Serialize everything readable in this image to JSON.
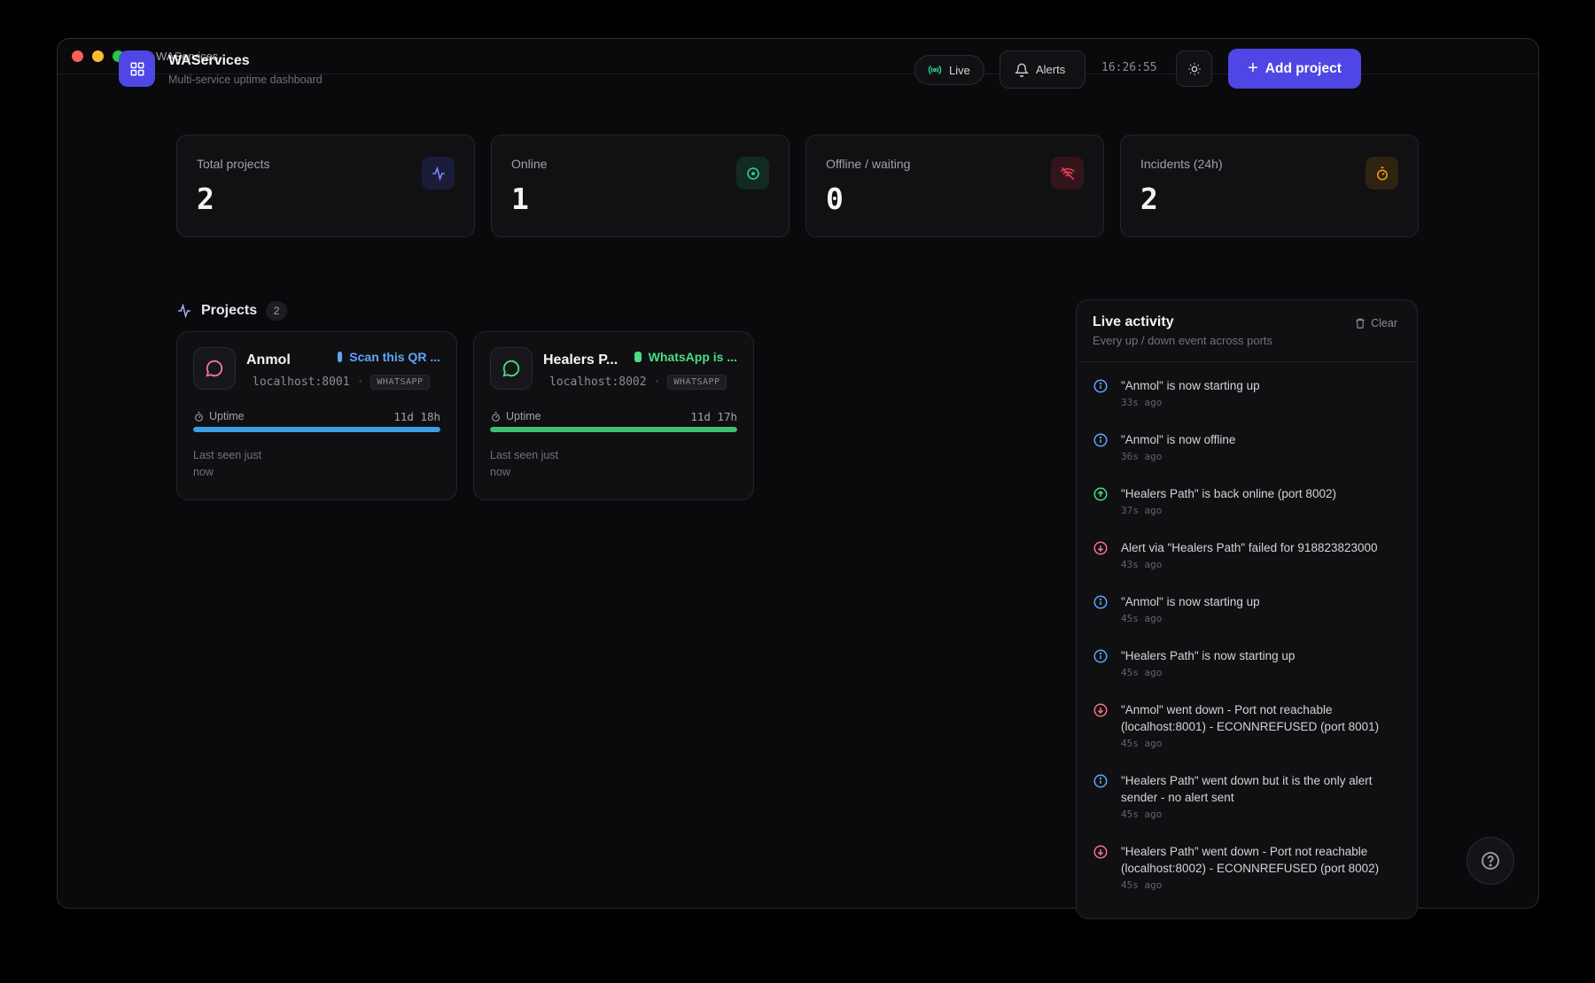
{
  "window": {
    "title": "WAServices"
  },
  "header": {
    "brand_name": "WAServices",
    "brand_sub": "Multi-service uptime dashboard",
    "live_label": "Live",
    "alerts_label": "Alerts",
    "clock": "16:26:55",
    "add_label": "Add project"
  },
  "stats": [
    {
      "label": "Total projects",
      "value": "2",
      "icon": "activity-icon",
      "color": "#818cf8"
    },
    {
      "label": "Online",
      "value": "1",
      "icon": "online-dot-icon",
      "color": "#34d399"
    },
    {
      "label": "Offline / waiting",
      "value": "0",
      "icon": "wifi-off-icon",
      "color": "#f43f5e"
    },
    {
      "label": "Incidents (24h)",
      "value": "2",
      "icon": "timer-icon",
      "color": "#f59e0b"
    }
  ],
  "projects": {
    "title": "Projects",
    "count": "2",
    "items": [
      {
        "name": "Anmol",
        "host": "localhost:8001",
        "tag": "WHATSAPP",
        "status": "Scan this QR ...",
        "status_color": "#60a5fa",
        "uptime_label": "Uptime",
        "uptime": "11d 18h",
        "uptime_fraction": 1.0,
        "bar_color": "#3b9fe0",
        "last_seen": "Last seen just now"
      },
      {
        "name": "Healers P...",
        "host": "localhost:8002",
        "tag": "WHATSAPP",
        "status": "WhatsApp is ...",
        "status_color": "#4ade80",
        "uptime_label": "Uptime",
        "uptime": "11d 17h",
        "uptime_fraction": 1.0,
        "bar_color": "#3fbf73",
        "last_seen": "Last seen just now"
      }
    ]
  },
  "activity": {
    "title": "Live activity",
    "subtitle": "Every up / down event across ports",
    "clear_label": "Clear",
    "items": [
      {
        "type": "info",
        "text": "\"Anmol\" is now starting up",
        "time": "33s ago"
      },
      {
        "type": "info",
        "text": "\"Anmol\" is now offline",
        "time": "36s ago"
      },
      {
        "type": "up",
        "text": "\"Healers Path\" is back online (port 8002)",
        "time": "37s ago"
      },
      {
        "type": "down",
        "text": "Alert via \"Healers Path\" failed for 918823823000",
        "time": "43s ago"
      },
      {
        "type": "info",
        "text": "\"Anmol\" is now starting up",
        "time": "45s ago"
      },
      {
        "type": "info",
        "text": "\"Healers Path\" is now starting up",
        "time": "45s ago"
      },
      {
        "type": "down",
        "text": "\"Anmol\" went down - Port not reachable (localhost:8001) - ECONNREFUSED (port 8001)",
        "time": "45s ago"
      },
      {
        "type": "info",
        "text": "\"Healers Path\" went down but it is the only alert sender - no alert sent",
        "time": "45s ago"
      },
      {
        "type": "down",
        "text": "\"Healers Path\" went down - Port not reachable (localhost:8002) - ECONNREFUSED (port 8002)",
        "time": "45s ago"
      }
    ]
  }
}
